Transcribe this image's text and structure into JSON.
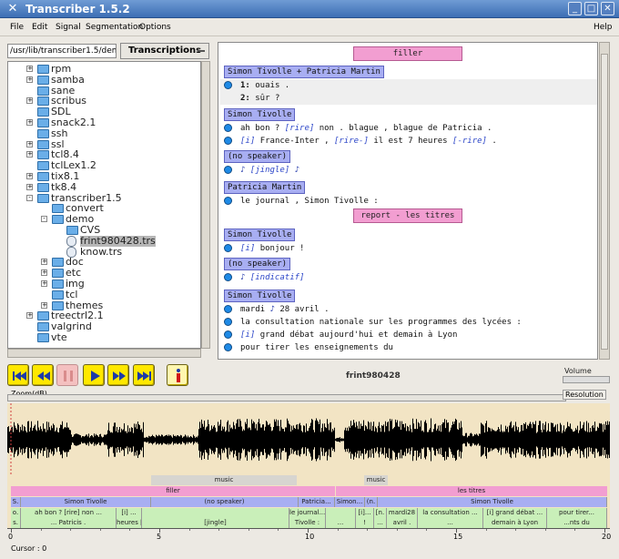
{
  "window": {
    "title": "Transcriber 1.5.2",
    "icon": "app-icon"
  },
  "menu": [
    "File",
    "Edit",
    "Signal",
    "Segmentation",
    "Options"
  ],
  "help": "Help",
  "browser": {
    "path": "/usr/lib/transcriber1.5/demo",
    "dropdown": "Transcriptions",
    "items": [
      {
        "label": "rpm",
        "type": "folder",
        "expand": "+"
      },
      {
        "label": "samba",
        "type": "folder",
        "expand": "+"
      },
      {
        "label": "sane",
        "type": "folder",
        "expand": ""
      },
      {
        "label": "scribus",
        "type": "folder",
        "expand": "+"
      },
      {
        "label": "SDL",
        "type": "folder",
        "expand": ""
      },
      {
        "label": "snack2.1",
        "type": "folder",
        "expand": "+"
      },
      {
        "label": "ssh",
        "type": "folder",
        "expand": ""
      },
      {
        "label": "ssl",
        "type": "folder",
        "expand": "+"
      },
      {
        "label": "tcl8.4",
        "type": "folder",
        "expand": "+"
      },
      {
        "label": "tclLex1.2",
        "type": "folder",
        "expand": ""
      },
      {
        "label": "tix8.1",
        "type": "folder",
        "expand": "+"
      },
      {
        "label": "tk8.4",
        "type": "folder",
        "expand": "+"
      },
      {
        "label": "transcriber1.5",
        "type": "folder",
        "expand": "-"
      },
      {
        "label": "convert",
        "type": "folder",
        "expand": ""
      },
      {
        "label": "demo",
        "type": "folder",
        "expand": "-"
      },
      {
        "label": "CVS",
        "type": "folder",
        "expand": ""
      },
      {
        "label": "frint980428.trs",
        "type": "file",
        "expand": "",
        "selected": true
      },
      {
        "label": "know.trs",
        "type": "file",
        "expand": ""
      },
      {
        "label": "doc",
        "type": "folder",
        "expand": "+"
      },
      {
        "label": "etc",
        "type": "folder",
        "expand": "+"
      },
      {
        "label": "img",
        "type": "folder",
        "expand": "+"
      },
      {
        "label": "tcl",
        "type": "folder",
        "expand": ""
      },
      {
        "label": "themes",
        "type": "folder",
        "expand": "+"
      },
      {
        "label": "treectrl2.1",
        "type": "folder",
        "expand": "+"
      },
      {
        "label": "valgrind",
        "type": "folder",
        "expand": ""
      },
      {
        "label": "vte",
        "type": "folder",
        "expand": ""
      }
    ]
  },
  "editor": {
    "topic1": "filler",
    "spk1": "Simon Tivolle + Patricia Martin",
    "l1a_num": "1:",
    "l1a_txt": "ouais .",
    "l1b_num": "2:",
    "l1b_txt": "sûr ?",
    "spk2": "Simon Tivolle",
    "l2a_p1": "ah bon ?",
    "l2a_e1": "[rire]",
    "l2a_p2": "non . blague , blague de Patricia .",
    "l2b_e1": "[i]",
    "l2b_p1": "France-Inter ,",
    "l2b_e2": "[rire-]",
    "l2b_p2": "il est 7 heures",
    "l2b_e3": "[-rire]",
    "l2b_p3": ".",
    "spk3": "(no speaker)",
    "l3_note": "♪",
    "l3_e": "[jingle]",
    "l3_note2": "♪",
    "spk4": "Patricia Martin",
    "l4": "le journal , Simon Tivolle :",
    "topic2": "report - les titres",
    "spk5": "Simon Tivolle",
    "l5_e": "[i]",
    "l5_t": "bonjour !",
    "spk6": "(no speaker)",
    "l6_note": "♪",
    "l6_e": "[indicatif]",
    "spk7": "Simon Tivolle",
    "l7a_t1": "mardi",
    "l7a_note": "♪",
    "l7a_t2": "28 avril .",
    "l7b": "la consultation nationale sur les programmes des lycées :",
    "l7c_e": "[i]",
    "l7c_t": "grand débat aujourd'hui et demain à Lyon",
    "l7d": "pour tirer les enseignements du"
  },
  "transport": {
    "buttons": [
      "rewind-fast",
      "rewind",
      "pause",
      "play",
      "forward",
      "forward-fast",
      "info"
    ],
    "filename": "frint980428",
    "volume_label": "Volume",
    "zoom_label": "Zoom(dB)",
    "resolution_label": "Resolution"
  },
  "segmentation": {
    "music_labels": [
      "music",
      "music"
    ],
    "topic_labels": [
      "filler",
      "les titres"
    ],
    "speaker_labels": [
      "S.",
      "Simon Tivolle",
      "(no speaker)",
      "Patricia...",
      "Simon...",
      "(n.",
      "Simon Tivolle"
    ],
    "seg_row1": [
      "o.",
      "ah bon ? [rire] non ...",
      "[i] ...",
      "",
      "le journal...",
      "",
      "[i]...",
      "[n.",
      "mardi28",
      "la consultation ...",
      "[i] grand débat ...",
      "pour tirer..."
    ],
    "seg_row2": [
      "s.",
      "... Patricis .",
      "heures [-rire] .",
      "[jingle]",
      "Tivolle :",
      "...",
      "!",
      "...",
      "avril .",
      "...",
      "demain à Lyon",
      "...nts du"
    ]
  },
  "axis": {
    "ticks": [
      "0",
      "5",
      "10",
      "15",
      "20"
    ]
  },
  "status": {
    "cursor": "Cursor : 0"
  },
  "colors": {
    "topic": "#f29ed1",
    "speaker": "#a8aef2",
    "music": "#d7d5d0",
    "segment": "#c9efb9",
    "wave_bg": "#f2e4c4",
    "transport": "#ffe800"
  }
}
